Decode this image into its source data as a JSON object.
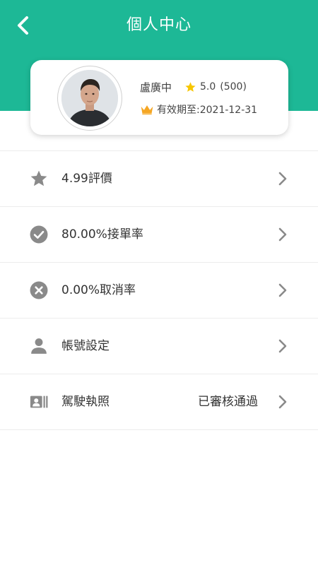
{
  "header": {
    "title": "個人中心",
    "back_icon": "chevron-left-icon",
    "background_color": "#1db896"
  },
  "profile": {
    "name": "盧廣中",
    "rating": "5.0",
    "rating_count": "(500)",
    "rating_icon": "star-icon",
    "star_color": "#f7c600",
    "validity": "有效期至:2021-12-31",
    "validity_icon": "crown-icon",
    "crown_color": "#f5a623"
  },
  "menu": {
    "items": [
      {
        "icon": "star-icon",
        "label": "4.99評價",
        "value": ""
      },
      {
        "icon": "check-circle-icon",
        "label": "80.00%接單率",
        "value": ""
      },
      {
        "icon": "cancel-circle-icon",
        "label": "0.00%取消率",
        "value": ""
      },
      {
        "icon": "person-icon",
        "label": "帳號設定",
        "value": ""
      },
      {
        "icon": "id-card-icon",
        "label": "駕駛執照",
        "value": "已審核通過"
      }
    ]
  }
}
